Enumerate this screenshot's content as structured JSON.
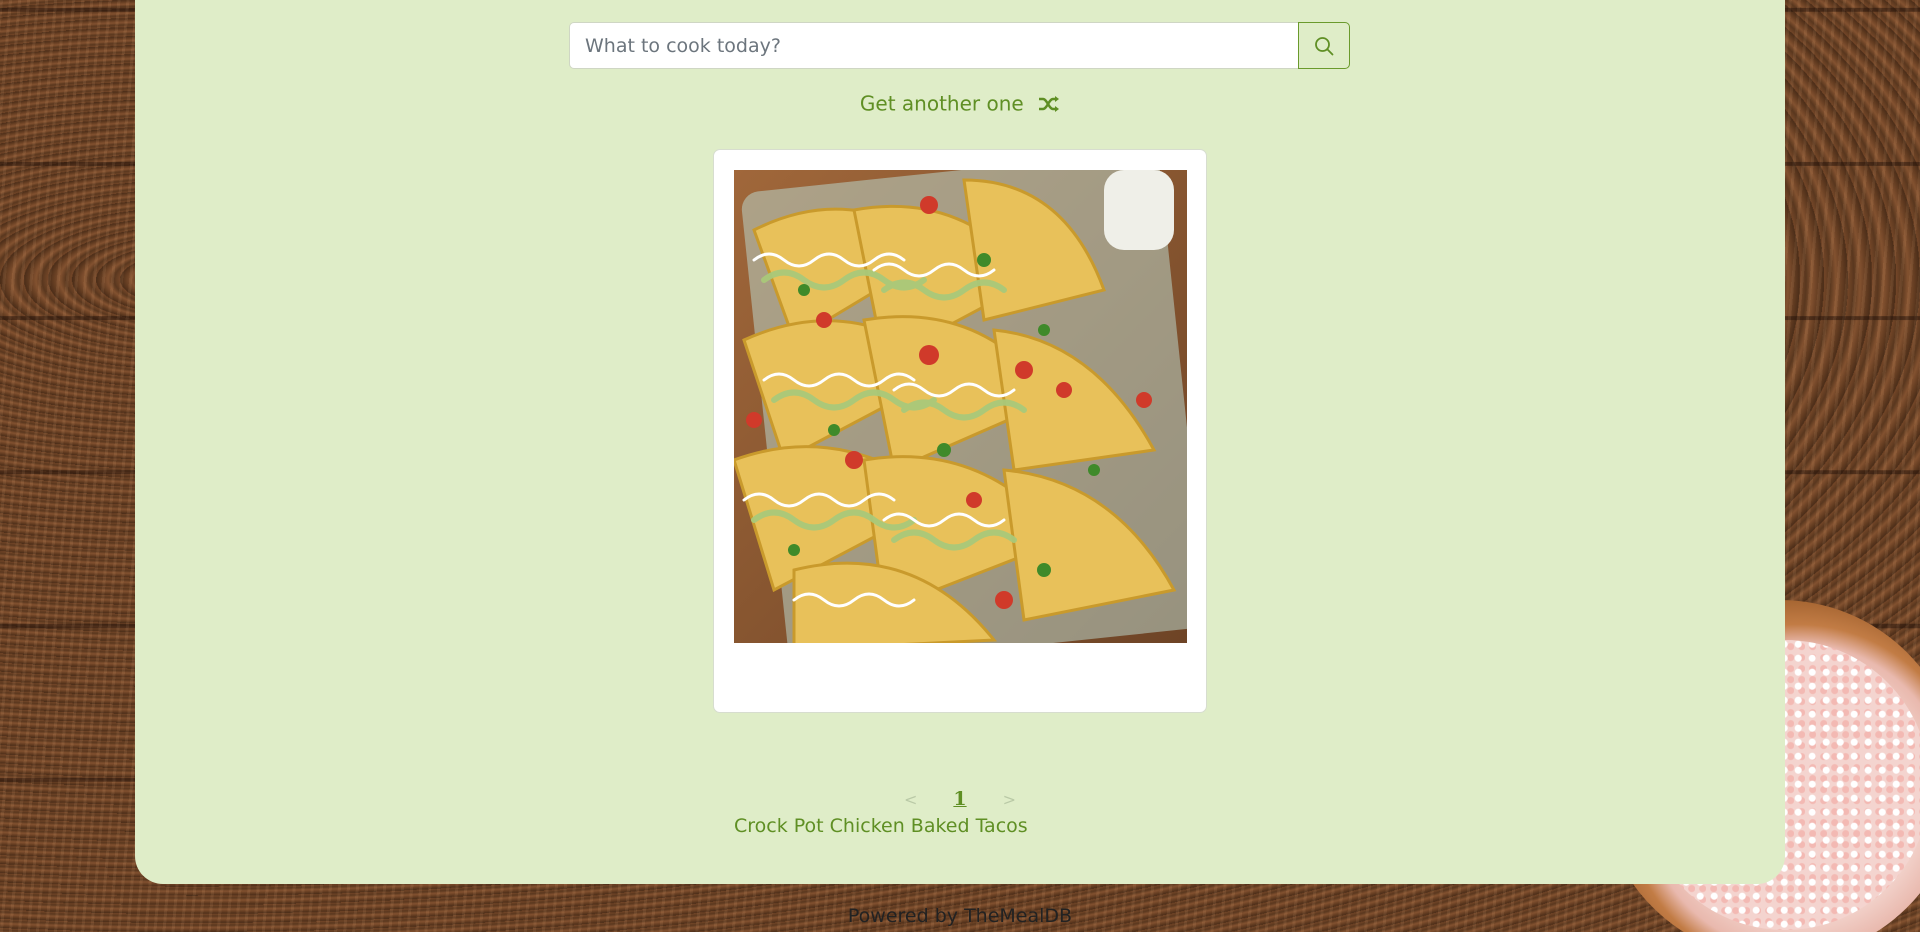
{
  "search": {
    "placeholder": "What to cook today?",
    "value": "",
    "button_icon": "search-icon"
  },
  "random": {
    "label": "Get another one",
    "icon": "shuffle-icon"
  },
  "results": [
    {
      "title": "Crock Pot Chicken Baked Tacos",
      "image_alt": "Crock Pot Chicken Baked Tacos"
    }
  ],
  "pagination": {
    "prev_label": "<",
    "current_page": "1",
    "next_label": ">"
  },
  "footer": {
    "text": "Powered by TheMealDB"
  },
  "colors": {
    "panel_bg": "#dfedc8",
    "accent": "#5f8f24",
    "card_bg": "#ffffff"
  }
}
